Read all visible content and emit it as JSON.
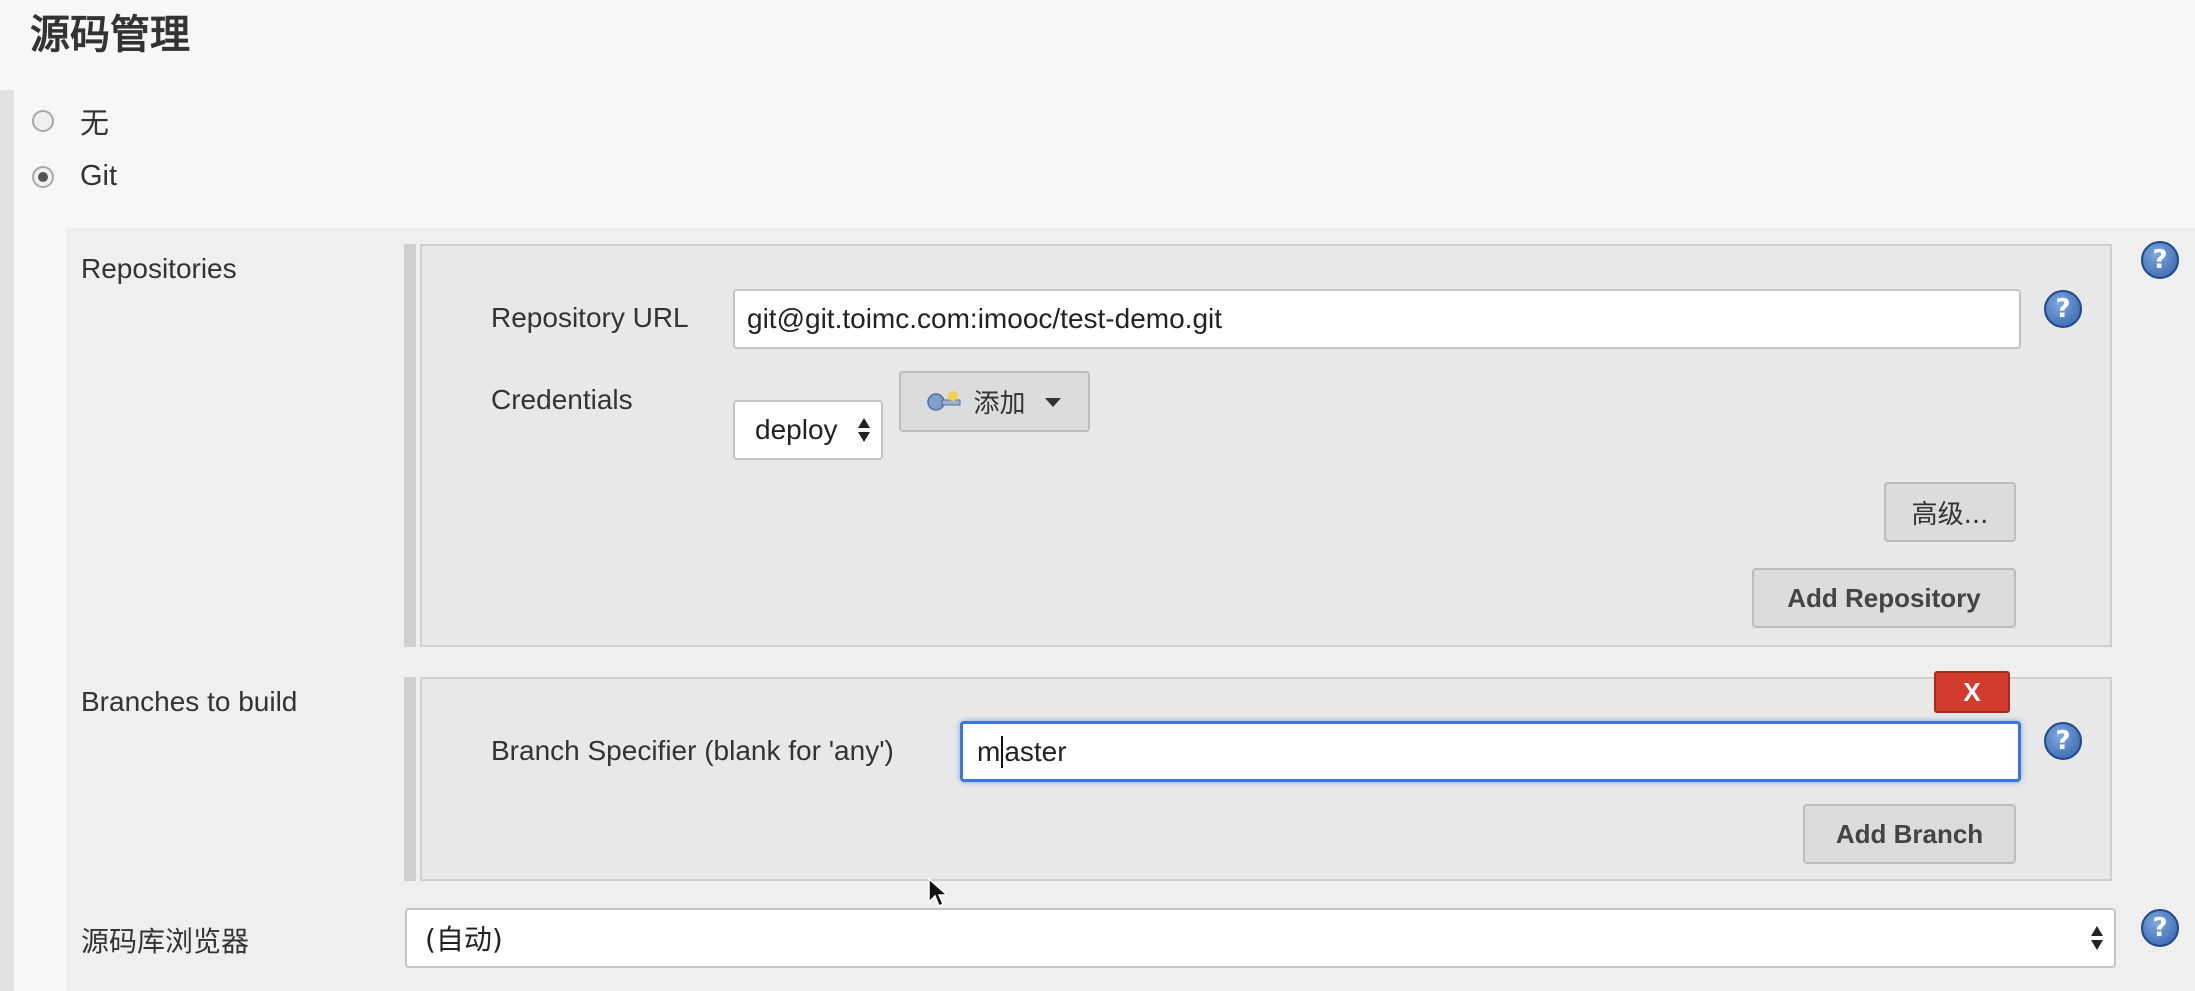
{
  "section": {
    "title": "源码管理"
  },
  "scm_options": [
    {
      "label": "无",
      "selected": false
    },
    {
      "label": "Git",
      "selected": true
    }
  ],
  "repositories": {
    "label": "Repositories",
    "url_label": "Repository URL",
    "url_value": "git@git.toimc.com:imooc/test-demo.git",
    "credentials_label": "Credentials",
    "credentials_value": "deploy",
    "add_label": "添加",
    "advanced_label": "高级...",
    "add_repository_label": "Add Repository"
  },
  "branches": {
    "label": "Branches to build",
    "specifier_label": "Branch Specifier (blank for 'any')",
    "specifier_value_before_caret": "m",
    "specifier_value_after_caret": "aster",
    "delete_label": "X",
    "add_branch_label": "Add Branch"
  },
  "browser": {
    "label": "源码库浏览器",
    "value": "(自动)"
  },
  "help_symbol": "?",
  "colors": {
    "accent_focus": "#3a78d8",
    "delete_red": "#d23b2e",
    "help_blue": "#2f5fa8"
  }
}
